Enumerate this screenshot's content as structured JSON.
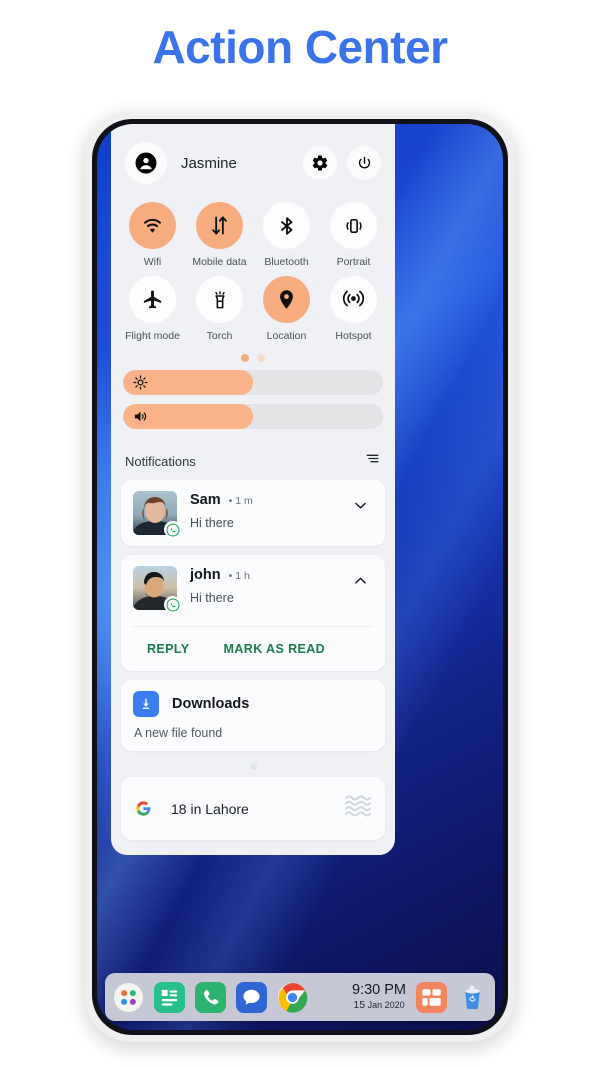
{
  "page": {
    "title": "Action Center",
    "title_color": "#3b73ea"
  },
  "status": {
    "accent": "#f7ac7f",
    "green": "#1d7a50",
    "blue": "#3b7ef0"
  },
  "action_center": {
    "user_name": "Jasmine",
    "avatar_icon": "account-circle-icon",
    "settings_icon": "gear-icon",
    "power_icon": "power-icon",
    "tiles": [
      {
        "label": "Wifi",
        "icon": "wifi-icon",
        "active": true
      },
      {
        "label": "Mobile data",
        "icon": "mobile-data-icon",
        "active": true
      },
      {
        "label": "Bluetooth",
        "icon": "bluetooth-icon",
        "active": false
      },
      {
        "label": "Portrait",
        "icon": "portrait-icon",
        "active": false
      },
      {
        "label": "Flight mode",
        "icon": "airplane-icon",
        "active": false
      },
      {
        "label": "Torch",
        "icon": "torch-icon",
        "active": false
      },
      {
        "label": "Location",
        "icon": "location-pin-icon",
        "active": true
      },
      {
        "label": "Hotspot",
        "icon": "hotspot-icon",
        "active": false
      }
    ],
    "page_dots": {
      "count": 2,
      "active_index": 0
    },
    "sliders": [
      {
        "name": "brightness",
        "icon": "brightness-icon",
        "value": 50
      },
      {
        "name": "volume",
        "icon": "volume-icon",
        "value": 50
      }
    ],
    "notifications_header": {
      "label": "Notifications",
      "clear_icon": "sort-lines-icon"
    },
    "notifications": [
      {
        "type": "message",
        "sender": "Sam",
        "separator": "•",
        "time": "1 m",
        "message": "Hi there",
        "app_badge": "whatsapp-icon",
        "expanded": false,
        "chevron": "chevron-down-icon",
        "avatar_kind": "woman-photo"
      },
      {
        "type": "message",
        "sender": "john",
        "separator": "•",
        "time": "1 h",
        "message": "Hi there",
        "app_badge": "whatsapp-icon",
        "expanded": true,
        "chevron": "chevron-up-icon",
        "avatar_kind": "man-photo",
        "actions": [
          "REPLY",
          "MARK AS READ"
        ]
      },
      {
        "type": "app",
        "title": "Downloads",
        "subtitle": "A new file found",
        "icon": "download-icon"
      }
    ],
    "weather_card": {
      "brand_icon": "google-g-icon",
      "text": "18 in Lahore",
      "weather_icon": "fog-waves-icon"
    }
  },
  "dock": {
    "apps": [
      {
        "name": "app-drawer",
        "icon": "app-drawer-icon"
      },
      {
        "name": "notes",
        "icon": "notes-icon"
      },
      {
        "name": "phone",
        "icon": "phone-icon"
      },
      {
        "name": "messages",
        "icon": "messages-icon"
      },
      {
        "name": "chrome",
        "icon": "chrome-icon"
      }
    ],
    "clock": {
      "time": "9:30 PM",
      "day": "15",
      "month": "Jan",
      "year": "2020"
    },
    "tray": [
      {
        "name": "widgets",
        "icon": "widgets-icon"
      },
      {
        "name": "recycle-bin",
        "icon": "recycle-bin-icon"
      }
    ]
  }
}
